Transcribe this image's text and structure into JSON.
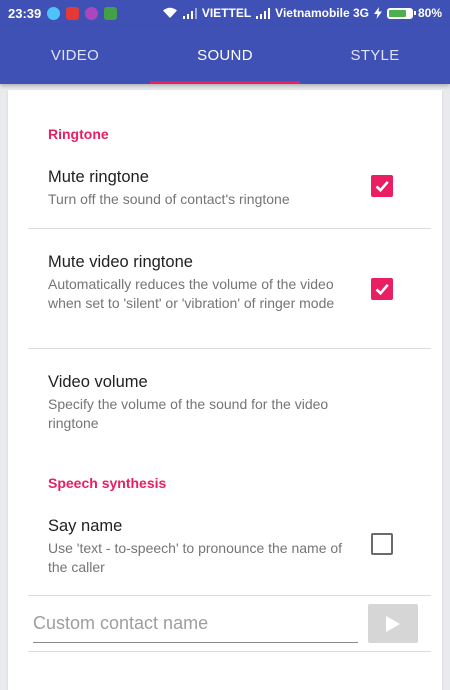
{
  "status_bar": {
    "time": "23:39",
    "carrier1": "VIETTEL",
    "carrier2": "Vietnamobile 3G",
    "battery": "80%",
    "battery_level": 0.8
  },
  "tabs": [
    {
      "label": "VIDEO",
      "active": false
    },
    {
      "label": "SOUND",
      "active": true
    },
    {
      "label": "STYLE",
      "active": false
    }
  ],
  "colors": {
    "primary": "#3f51b5",
    "accent": "#e91e63"
  },
  "sections": {
    "ringtone": {
      "header": "Ringtone",
      "mute_ringtone": {
        "title": "Mute ringtone",
        "summary": "Turn off the sound of contact's ringtone",
        "checked": true
      },
      "mute_video_ringtone": {
        "title": "Mute video ringtone",
        "summary": "Automatically reduces the volume of the video when set to 'silent' or 'vibration' of ringer mode",
        "checked": true
      },
      "video_volume": {
        "title": "Video volume",
        "summary": "Specify the volume of the sound for the video ringtone"
      }
    },
    "speech": {
      "header": "Speech synthesis",
      "say_name": {
        "title": "Say name",
        "summary": "Use 'text - to-speech' to pronounce the name of the caller",
        "checked": false
      },
      "custom_name": {
        "placeholder": "Custom contact name",
        "value": ""
      }
    }
  }
}
